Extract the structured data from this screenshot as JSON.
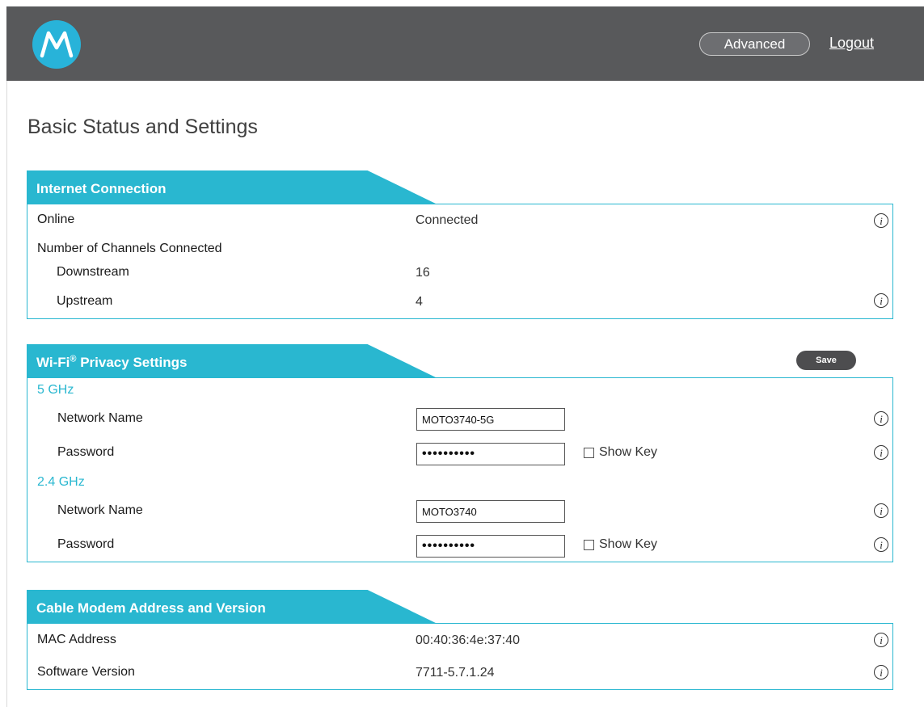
{
  "header": {
    "advanced_label": "Advanced",
    "logout_label": "Logout"
  },
  "page_title": "Basic Status and Settings",
  "internet": {
    "title": "Internet Connection",
    "online_label": "Online",
    "online_value": "Connected",
    "channels_label": "Number of Channels Connected",
    "downstream_label": "Downstream",
    "downstream_value": "16",
    "upstream_label": "Upstream",
    "upstream_value": "4"
  },
  "wifi": {
    "title": "Wi-Fi",
    "title_sup": "®",
    "title_rest": " Privacy Settings",
    "save_label": "Save",
    "band5": {
      "label": "5 GHz",
      "network_name_label": "Network Name",
      "network_name_value": "MOTO3740-5G",
      "password_label": "Password",
      "password_value": "••••••••••",
      "show_key_label": "Show Key"
    },
    "band24": {
      "label": "2.4 GHz",
      "network_name_label": "Network Name",
      "network_name_value": "MOTO3740",
      "password_label": "Password",
      "password_value": "••••••••••",
      "show_key_label": "Show Key"
    }
  },
  "modem": {
    "title": "Cable Modem Address and Version",
    "mac_label": "MAC Address",
    "mac_value": "00:40:36:4e:37:40",
    "sw_label": "Software Version",
    "sw_value": "7711-5.7.1.24"
  },
  "icons": {
    "info": "i"
  },
  "colors": {
    "accent": "#29b7d0",
    "header_bg": "#58595b",
    "logo_bg": "#28b3d9"
  }
}
